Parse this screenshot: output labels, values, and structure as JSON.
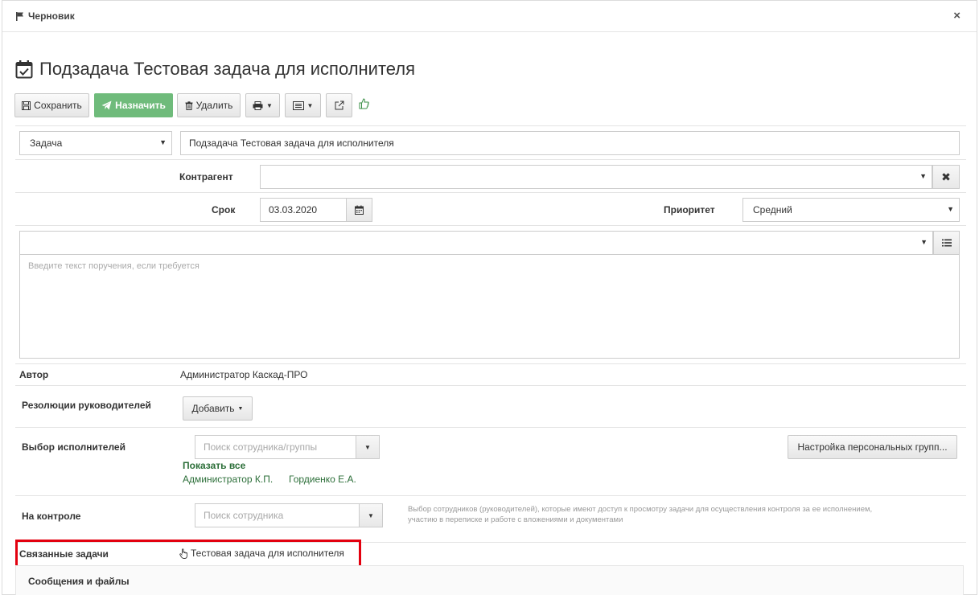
{
  "dialog": {
    "title": "Черновик",
    "close_icon": "×"
  },
  "page": {
    "title": "Подзадача Тестовая задача для исполнителя"
  },
  "toolbar": {
    "save_label": "Сохранить",
    "assign_label": "Назначить",
    "delete_label": "Удалить",
    "assign_color": "#6fbb7b"
  },
  "form": {
    "type_value": "Задача",
    "name_value": "Подзадача Тестовая задача для исполнителя",
    "counterparty_label": "Контрагент",
    "counterparty_value": "",
    "deadline_label": "Срок",
    "deadline_value": "03.03.2020",
    "priority_label": "Приоритет",
    "priority_value": "Средний",
    "template_value": "",
    "text_placeholder": "Введите текст поручения, если требуется"
  },
  "author": {
    "label": "Автор",
    "value": "Администратор Каскад-ПРО"
  },
  "resolutions": {
    "label": "Резолюции руководителей",
    "add_label": "Добавить"
  },
  "executors": {
    "label": "Выбор исполнителей",
    "search_placeholder": "Поиск сотрудника/группы",
    "personal_groups_button": "Настройка персональных групп...",
    "show_all": "Показать все",
    "people": [
      "Администратор К.П.",
      "Гордиенко Е.А."
    ]
  },
  "control": {
    "label": "На контроле",
    "search_placeholder": "Поиск сотрудника",
    "help_line1": "Выбор сотрудников (руководителей), которые имеют доступ к просмотру задачи для осуществления контроля за ее исполнением,",
    "help_line2": "участию в переписке и работе с вложениями и документами"
  },
  "related": {
    "label": "Связанные задачи",
    "task_link": "Тестовая задача для исполнителя",
    "highlight_color": "#e3000f"
  },
  "messages": {
    "title": "Сообщения и файлы"
  }
}
